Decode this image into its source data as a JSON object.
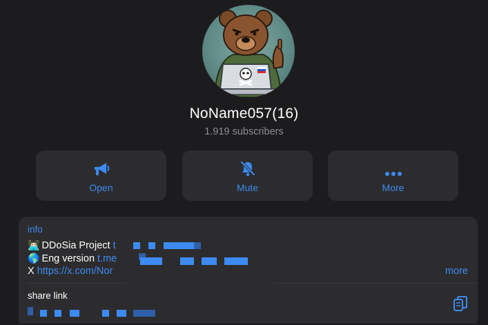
{
  "channel": {
    "name": "NoName057(16)",
    "subscribers": "1.919 subscribers",
    "avatar_icon": "bear-avatar-icon"
  },
  "actions": [
    {
      "label": "Open",
      "icon": "megaphone-icon"
    },
    {
      "label": "Mute",
      "icon": "bell-slash-icon"
    },
    {
      "label": "More",
      "icon": "ellipsis-icon"
    }
  ],
  "info": {
    "label": "info",
    "lines": [
      {
        "emoji": "👨🏻‍💻",
        "text": "DDoSia Project ",
        "link": "t"
      },
      {
        "emoji": "🌎",
        "text": "Eng version ",
        "link": "t.me"
      },
      {
        "prefix": "X ",
        "link": "https://x.com/Nor"
      }
    ],
    "more_label": "more"
  },
  "share": {
    "label": "share link",
    "copy_icon": "copy-icon"
  },
  "colors": {
    "background": "#1c1c1e",
    "card": "#2c2c2e",
    "accent": "#3d8bf2",
    "secondary_text": "#8e8e93"
  }
}
